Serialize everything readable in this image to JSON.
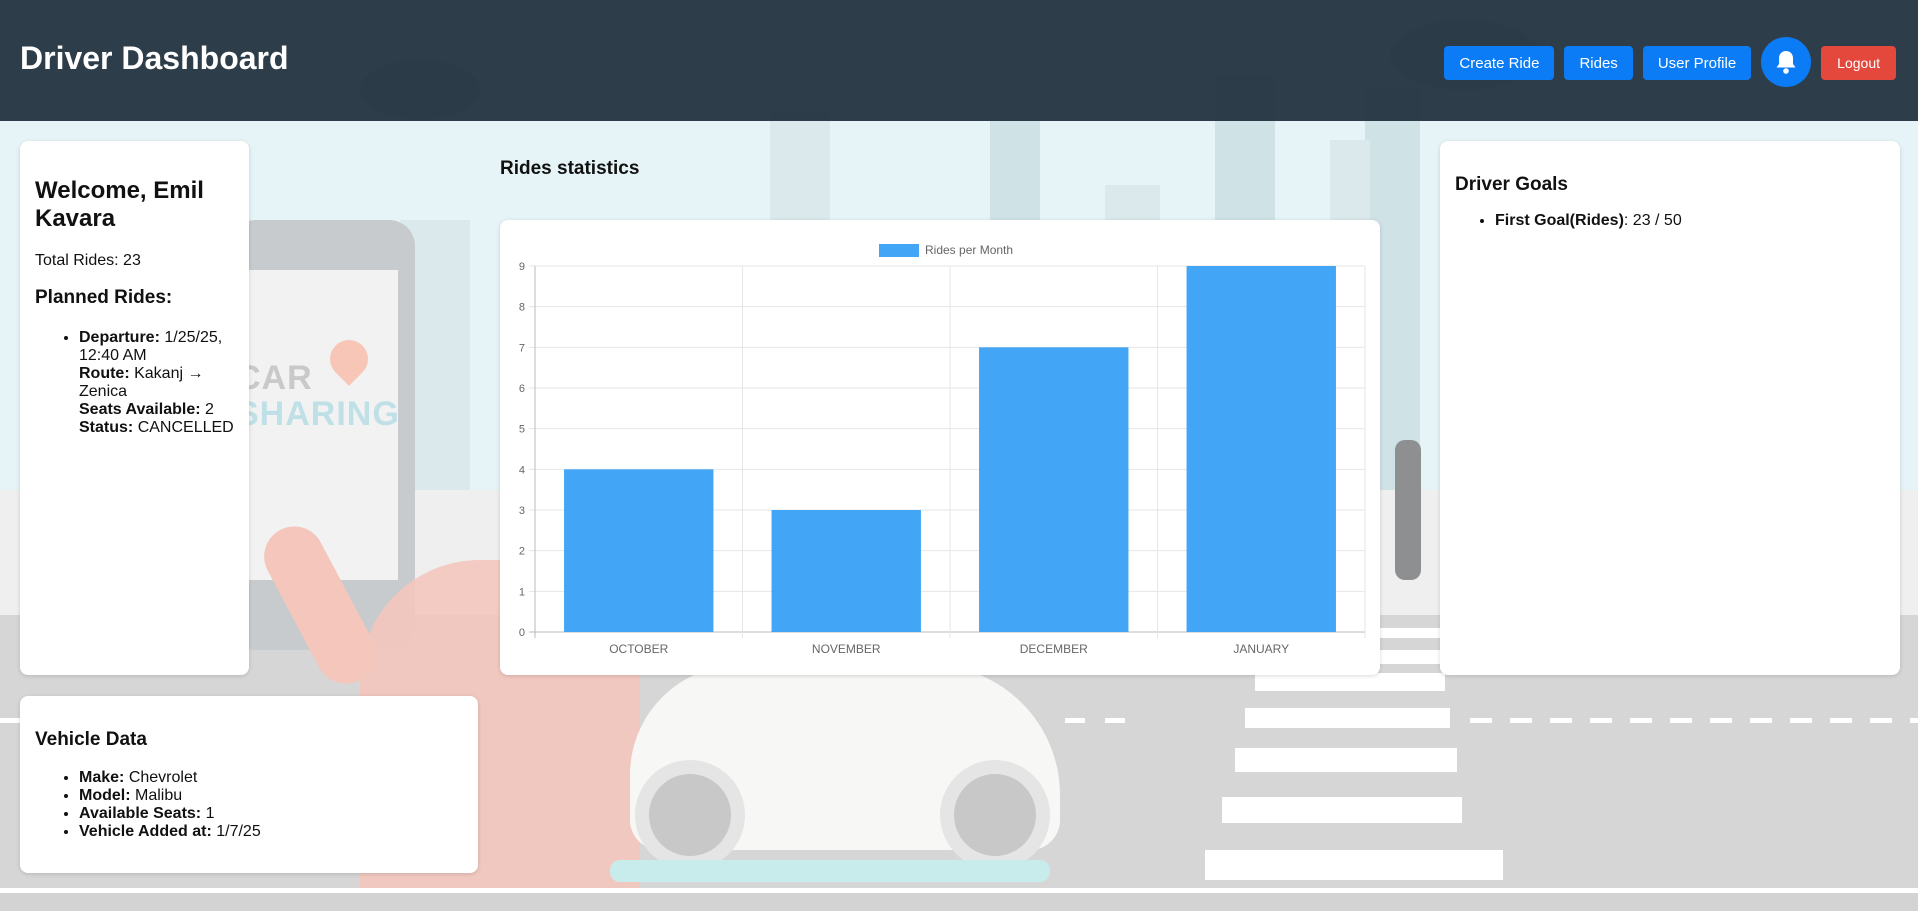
{
  "header": {
    "title": "Driver Dashboard",
    "nav": {
      "create_ride": "Create Ride",
      "rides": "Rides",
      "user_profile": "User Profile",
      "notifications_icon": "bell-icon",
      "logout": "Logout"
    }
  },
  "welcome": {
    "heading": "Welcome, Emil Kavara",
    "total_rides": "Total Rides: 23",
    "planned_heading": "Planned Rides:",
    "ride": {
      "departure_label": "Departure:",
      "departure_value": "1/25/25, 12:40 AM",
      "route_label": "Route:",
      "route_value": "Kakanj → Zenica",
      "seats_label": "Seats Available:",
      "seats_value": "2",
      "status_label": "Status:",
      "status_value": "CANCELLED"
    }
  },
  "vehicle": {
    "heading": "Vehicle Data",
    "make_label": "Make:",
    "make_value": "Chevrolet",
    "model_label": "Model:",
    "model_value": "Malibu",
    "seats_label": "Available Seats:",
    "seats_value": "1",
    "added_label": "Vehicle Added at:",
    "added_value": "1/7/25"
  },
  "stats": {
    "title": "Rides statistics"
  },
  "goals": {
    "heading": "Driver Goals",
    "goal_label": "First Goal(Rides)",
    "goal_value": ": 23 / 50"
  },
  "chart_data": {
    "type": "bar",
    "categories": [
      "OCTOBER",
      "NOVEMBER",
      "DECEMBER",
      "JANUARY"
    ],
    "series": [
      {
        "name": "Rides per Month",
        "values": [
          4,
          3,
          7,
          9
        ]
      }
    ],
    "ylim": [
      0,
      9
    ],
    "yticks": [
      "0",
      "1",
      "2",
      "3",
      "4",
      "5",
      "6",
      "7",
      "8",
      "9"
    ],
    "grid": true,
    "legend": "top-center",
    "bar_color": "#42a5f5"
  },
  "colors": {
    "header_bg": "#233440",
    "primary": "#0b7cf5",
    "danger": "#e4483d"
  }
}
